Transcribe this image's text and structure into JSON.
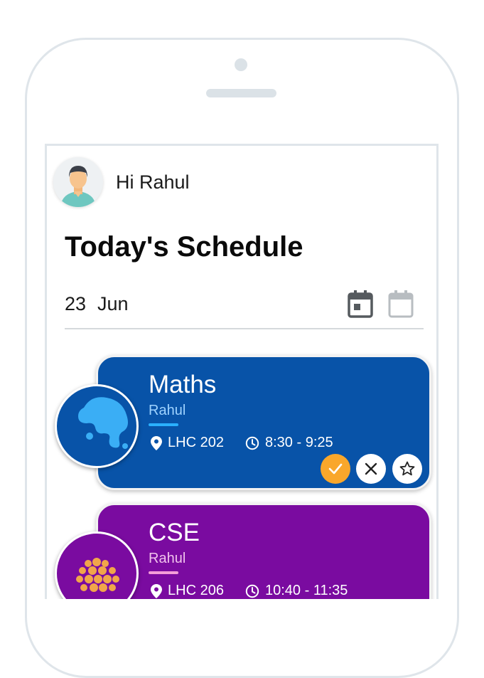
{
  "user": {
    "greeting": "Hi Rahul"
  },
  "page": {
    "title": "Today's Schedule"
  },
  "date": {
    "day": "23",
    "month": "Jun"
  },
  "colors": {
    "maths": "#0853a8",
    "cse": "#7a0ba0",
    "accent_check": "#f9a72b"
  },
  "icons": {
    "calendar_active": "calendar-today-icon",
    "calendar_inactive": "calendar-icon",
    "location": "location-pin-icon",
    "clock": "clock-icon",
    "check": "check-icon",
    "close": "close-icon",
    "star": "star-outline-icon"
  },
  "classes": [
    {
      "subject": "Maths",
      "teacher": "Rahul",
      "room": "LHC 202",
      "time": "8:30 - 9:25"
    },
    {
      "subject": "CSE",
      "teacher": "Rahul",
      "room": "LHC 206",
      "time": "10:40 - 11:35"
    }
  ]
}
